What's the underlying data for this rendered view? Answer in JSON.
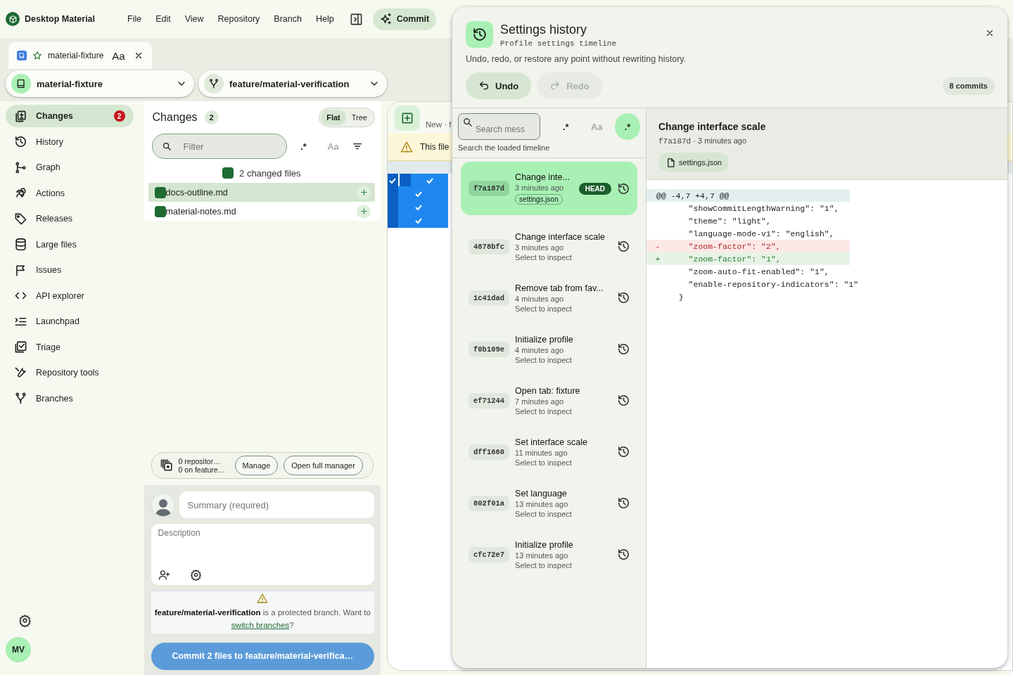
{
  "app": {
    "title": "Desktop Material"
  },
  "menu": [
    "File",
    "Edit",
    "View",
    "Repository",
    "Branch",
    "Help"
  ],
  "commit_button": {
    "label": "Commit"
  },
  "open_tabs": [
    {
      "label": "material-fixture",
      "font_label": "Aa",
      "favorite": false,
      "selected": true
    }
  ],
  "repository_selector": {
    "label": "material-fixture"
  },
  "branch_selector": {
    "label": "feature/material-verification"
  },
  "sidebar": {
    "items": [
      {
        "label": "Changes",
        "selected": true,
        "badge": "2"
      },
      {
        "label": "History",
        "selected": false
      },
      {
        "label": "Graph",
        "selected": false
      },
      {
        "label": "Actions",
        "selected": false
      },
      {
        "label": "Releases",
        "selected": false
      },
      {
        "label": "Large files",
        "selected": false
      },
      {
        "label": "Issues",
        "selected": false
      },
      {
        "label": "API explorer",
        "selected": false
      },
      {
        "label": "Launchpad",
        "selected": false
      },
      {
        "label": "Triage",
        "selected": false
      },
      {
        "label": "Repository tools",
        "selected": false
      },
      {
        "label": "Branches",
        "selected": false
      }
    ],
    "avatar_initials": "MV"
  },
  "changes": {
    "title": "Changes",
    "count": "2",
    "view_toggle": [
      {
        "label": "Flat",
        "selected": true
      },
      {
        "label": "Tree",
        "selected": false
      }
    ],
    "filter": {
      "placeholder": "Filter"
    },
    "filter_toggles": [
      {
        "label": ".*",
        "disabled": false
      },
      {
        "label": "Aa",
        "disabled": true
      }
    ],
    "summary": "2 changed files",
    "files": [
      {
        "name": "docs-outline.md",
        "selected": true
      },
      {
        "name": "material-notes.md",
        "selected": false
      }
    ]
  },
  "stash": {
    "line_1": "0 repositor…",
    "line_2": "0 on feature…",
    "buttons": [
      "Manage",
      "Open full manager"
    ]
  },
  "commit_form": {
    "summary_placeholder": "Summary (required)",
    "description_placeholder": "Description",
    "warning": {
      "message": "**feature/material-verification** is a protected branch. Want to",
      "link": "switch branches",
      "end": "?"
    },
    "submit": {
      "label": "Commit 2 files to feature/material-verifica…",
      "disabled": true
    }
  },
  "diff_view": {
    "toolbar_label": "New · f",
    "warning": "This file"
  },
  "history": {
    "title": "Settings history",
    "subtitle": "Profile settings timeline",
    "description": "Undo, redo, or restore any point without rewriting history.",
    "actions": [
      {
        "label": "Undo",
        "kind": "undo",
        "disabled": false
      },
      {
        "label": "Redo",
        "kind": "redo",
        "disabled": true
      }
    ],
    "count": "8 commits",
    "search": {
      "placeholder": "Search mess",
      "hint": "Search the loaded timeline"
    },
    "search_toggles": [
      {
        "label": ".*",
        "selected": false
      },
      {
        "label": "Aa",
        "selected": false
      },
      {
        "label": ".*",
        "selected": true
      }
    ],
    "commits": [
      {
        "hash": "f7a187d",
        "title": "Change inte...",
        "time": "3 minutes ago",
        "selected": true,
        "badge": "HEAD",
        "files": [
          "settings.json"
        ]
      },
      {
        "hash": "4878bfc",
        "title": "Change interface scale",
        "time": "3 minutes ago",
        "selected": false,
        "hint": "Select to inspect"
      },
      {
        "hash": "1c41dad",
        "title": "Remove tab from fav...",
        "time": "4 minutes ago",
        "selected": false,
        "hint": "Select to inspect"
      },
      {
        "hash": "f0b109e",
        "title": "Initialize profile",
        "time": "4 minutes ago",
        "selected": false,
        "hint": "Select to inspect"
      },
      {
        "hash": "ef71244",
        "title": "Open tab: fixture",
        "time": "7 minutes ago",
        "selected": false,
        "hint": "Select to inspect"
      },
      {
        "hash": "dff1660",
        "title": "Set interface scale",
        "time": "11 minutes ago",
        "selected": false,
        "hint": "Select to inspect"
      },
      {
        "hash": "802f01a",
        "title": "Set language",
        "time": "13 minutes ago",
        "selected": false,
        "hint": "Select to inspect"
      },
      {
        "hash": "cfc72e7",
        "title": "Initialize profile",
        "time": "13 minutes ago",
        "selected": false,
        "hint": "Select to inspect"
      }
    ],
    "detail": {
      "title": "Change interface scale",
      "hash": "f7a187d",
      "time": "· 3 minutes ago",
      "files": [
        "settings.json"
      ],
      "lines": [
        {
          "kind": "hunk",
          "text": "@@ -4,7 +4,7 @@"
        },
        {
          "kind": "context",
          "text": "    \"showCommitLengthWarning\": \"1\","
        },
        {
          "kind": "context",
          "text": "    \"theme\": \"light\","
        },
        {
          "kind": "context",
          "text": "    \"language-mode-v1\": \"english\","
        },
        {
          "kind": "removed",
          "sign": "-",
          "text": "    \"zoom-factor\": \"2\","
        },
        {
          "kind": "added",
          "sign": "+",
          "text": "    \"zoom-factor\": \"1\","
        },
        {
          "kind": "context",
          "text": "    \"zoom-auto-fit-enabled\": \"1\","
        },
        {
          "kind": "context",
          "text": "    \"enable-repository-indicators\": \"1\""
        },
        {
          "kind": "context",
          "text": "  }"
        }
      ]
    }
  }
}
